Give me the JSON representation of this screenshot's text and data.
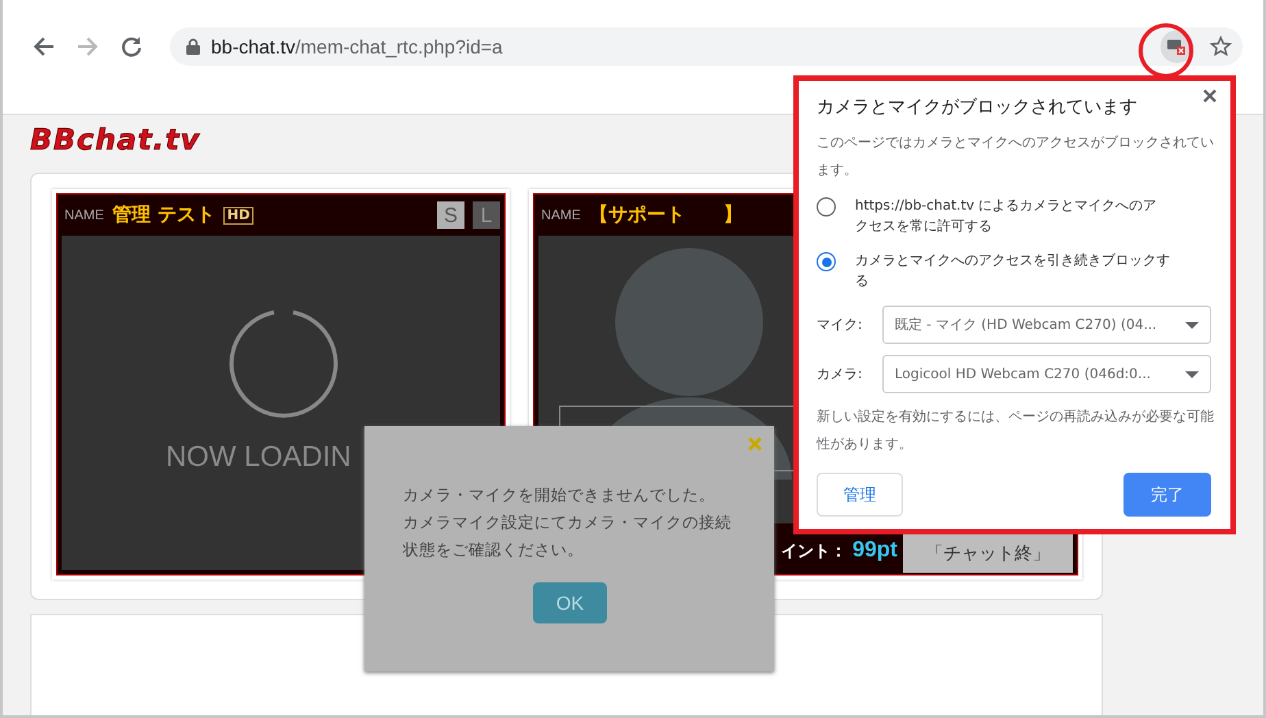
{
  "browser": {
    "nav": [
      {
        "kind": "back",
        "disabled": false
      },
      {
        "kind": "forward",
        "disabled": true
      },
      {
        "kind": "reload",
        "disabled": false
      }
    ],
    "url": {
      "host": "bb-chat.tv",
      "path": "/mem-chat_rtc.php?id=a"
    },
    "camera_blocked": true
  },
  "site": {
    "logo": "BBchat.tv"
  },
  "cards": [
    {
      "name_label": "NAME",
      "name": "管理 テスト",
      "badge": "HD",
      "size_buttons": [
        {
          "label": "S",
          "selected": true
        },
        {
          "label": "L",
          "selected": false
        }
      ],
      "video": {
        "kind": "loading",
        "text": "NOW LOADIN"
      }
    },
    {
      "name_label": "NAME",
      "name": "【サポート　　】",
      "video": {
        "kind": "avatar"
      },
      "points_label": "イント：",
      "points": "99pt",
      "end_button": "「チャット終」"
    }
  ],
  "error_dialog": {
    "message_lines": [
      "カメラ・マイクを開始できませんでした。",
      "カメラマイク設定にてカメラ・マイクの接続",
      "状態をご確認ください。"
    ],
    "ok_button": "OK"
  },
  "permission_popup": {
    "title": "カメラとマイクがブロックされています",
    "description": "このページではカメラとマイクへのアクセスがブロックされています。",
    "options": [
      {
        "label": "https://bb-chat.tv によるカメラとマイクへのアクセスを常に許可する",
        "selected": false
      },
      {
        "label": "カメラとマイクへのアクセスを引き続きブロックする",
        "selected": true
      }
    ],
    "devices": [
      {
        "label": "マイク:",
        "value": "既定 - マイク (HD Webcam C270) (04..."
      },
      {
        "label": "カメラ:",
        "value": "Logicool HD Webcam C270 (046d:0..."
      }
    ],
    "note": "新しい設定を有効にするには、ページの再読み込みが必要な可能性があります。",
    "manage_button": "管理",
    "done_button": "完了"
  }
}
